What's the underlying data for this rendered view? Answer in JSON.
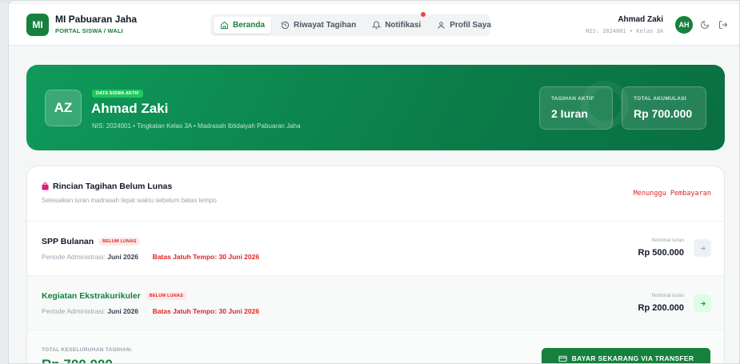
{
  "header": {
    "logo_text": "MI",
    "app_name": "MI Pabuaran Jaha",
    "app_sub": "PORTAL SISWA / WALI",
    "nav": [
      {
        "label": "Beranda",
        "icon": "home-icon",
        "active": true
      },
      {
        "label": "Riwayat Tagihan",
        "icon": "history-icon",
        "active": false
      },
      {
        "label": "Notifikasi",
        "icon": "bell-icon",
        "active": false
      },
      {
        "label": "Profil Saya",
        "icon": "user-icon",
        "active": false
      }
    ],
    "user_name": "Ahmad Zaki",
    "user_sub": "NIS: 2024001 • Kelas 3A",
    "avatar_initials": "AH"
  },
  "hero": {
    "initials": "AZ",
    "badge": "DATA SISWA AKTIF",
    "name": "Ahmad Zaki",
    "meta": "NIS: 2024001 • Tingkatan Kelas 3A • Madrasah Ibtidaiyah Pabuaran Jaha",
    "stats": [
      {
        "label": "TAGIHAN AKTIF",
        "value": "2 Iuran"
      },
      {
        "label": "TOTAL AKUMULASI",
        "value": "Rp 700.000"
      }
    ]
  },
  "bills": {
    "title": "Rincian Tagihan Belum Lunas",
    "subtitle": "Selesaikan iuran madrasah tepat waktu sebelum batas tempo",
    "status": "Menunggu Pembayaran",
    "items": [
      {
        "name": "SPP Bulanan",
        "badge": "BELUM LUNAS",
        "period_label": "Periode Administrasi:",
        "period_value": "Juni 2026",
        "due": "Batas Jatuh Tempo: 30 Juni 2026",
        "nominal_label": "Nominal Iuran",
        "nominal_value": "Rp 500.000"
      },
      {
        "name": "Kegiatan Ekstrakurikuler",
        "badge": "BELUM LUNAS",
        "period_label": "Periode Administrasi:",
        "period_value": "Juni 2026",
        "due": "Batas Jatuh Tempo: 30 Juni 2026",
        "nominal_label": "Nominal Iuran",
        "nominal_value": "Rp 200.000"
      }
    ],
    "total_label": "TOTAL KESELURUHAN TAGIHAN:",
    "total_value": "Rp 700.000",
    "pay_label": "BAYAR SEKARANG VIA TRANSFER"
  },
  "colors": {
    "primary": "#16803d",
    "danger": "#dc2626"
  }
}
